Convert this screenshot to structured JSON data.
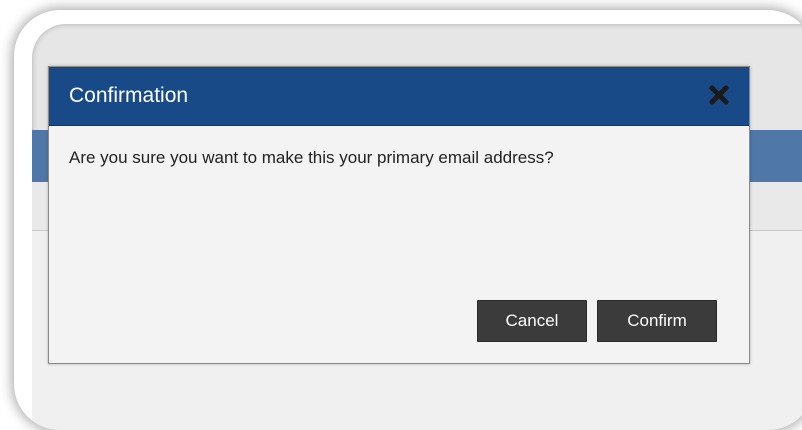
{
  "dialog": {
    "title": "Confirmation",
    "message": "Are you sure you want to make this your primary email address?",
    "close_icon": "close-icon",
    "cancel_label": "Cancel",
    "confirm_label": "Confirm"
  },
  "colors": {
    "header": "#184a88",
    "page_bar": "#4f78a8",
    "button": "#3b3b3b",
    "dialog_body": "#f3f3f3"
  }
}
